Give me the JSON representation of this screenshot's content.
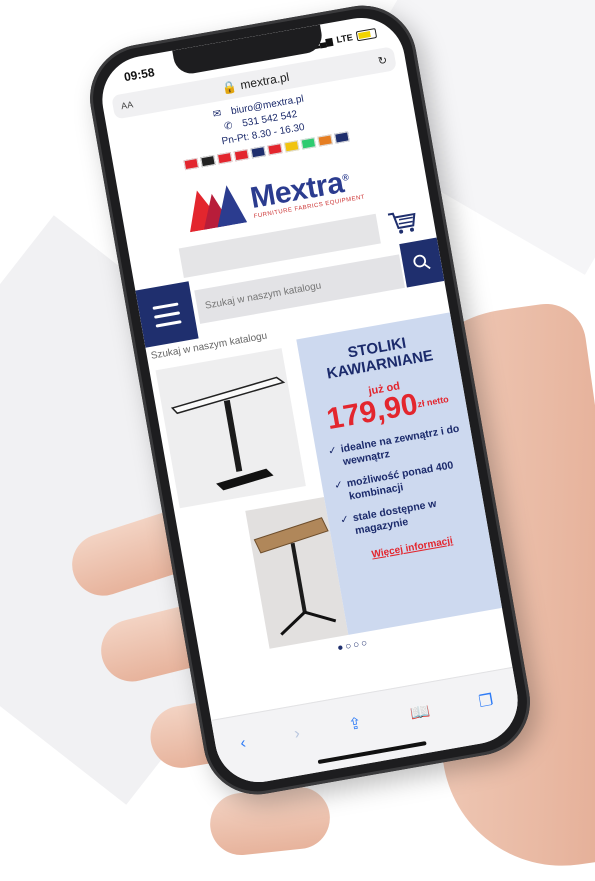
{
  "status": {
    "time": "09:58",
    "network": "LTE"
  },
  "browser": {
    "aa_label": "AA",
    "url": "mextra.pl"
  },
  "contact": {
    "email": "biuro@mextra.pl",
    "phone": "531 542 542",
    "hours": "Pn-Pt: 8.30 - 16.30"
  },
  "flags": [
    "#e3262e",
    "#222222",
    "#e3262e",
    "#e3262e",
    "#1f2f6e",
    "#e3262e",
    "#f1c40f",
    "#2ecc71",
    "#e67e22",
    "#1f2f6e"
  ],
  "brand": {
    "name": "Mextra",
    "registered": "®",
    "tagline": "FURNITURE FABRICS EQUIPMENT",
    "primary_color": "#2b3c8f",
    "accent_color": "#e3262e"
  },
  "search": {
    "placeholder": "Szukaj w naszym katalogu"
  },
  "promo": {
    "title_line1": "STOLIKI",
    "title_line2": "KAWIARNIANE",
    "from_label": "już od",
    "price": "179,90",
    "currency": "zł",
    "net_label": "netto",
    "bullets": [
      "idealne na zewnątrz i do wewnątrz",
      "możliwość ponad 400 kombinacji",
      "stale dostępne w magazynie"
    ],
    "more_link": "Więcej informacji"
  },
  "carousel": {
    "dots": "●○○○"
  },
  "toolbar": [
    "back-icon",
    "forward-icon",
    "share-icon",
    "bookmarks-icon",
    "tabs-icon"
  ]
}
